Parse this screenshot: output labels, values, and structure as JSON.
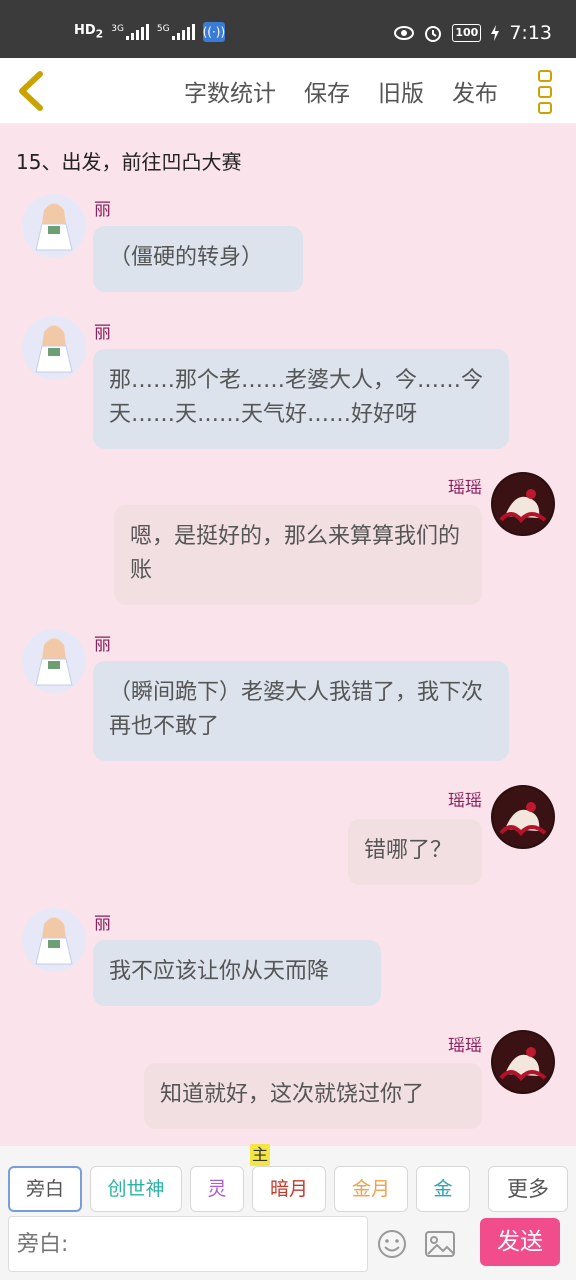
{
  "status_bar": {
    "hd": "HD",
    "hd_sub": "2",
    "sig1_label": "3G",
    "sig2_label": "5G",
    "wifi_label": "((·))",
    "battery": "100",
    "time": "7:13",
    "icons": [
      "eye-icon",
      "alarm-icon",
      "charging-icon"
    ]
  },
  "toolbar": {
    "actions": [
      "字数统计",
      "保存",
      "旧版",
      "发布"
    ],
    "accent_color": "#c9a300"
  },
  "chat": {
    "chapter_title": "15、出发，前往凹凸大赛",
    "messages": [
      {
        "side": "left",
        "name": "丽",
        "text": "（僵硬的转身）"
      },
      {
        "side": "left",
        "name": "丽",
        "text": "那……那个老……老婆大人，今……今天……天……天气好……好好呀"
      },
      {
        "side": "right",
        "name": "瑶瑶",
        "text": "嗯，是挺好的，那么来算算我们的账"
      },
      {
        "side": "left",
        "name": "丽",
        "text": "（瞬间跪下）老婆大人我错了，我下次再也不敢了"
      },
      {
        "side": "right",
        "name": "瑶瑶",
        "text": "错哪了？"
      },
      {
        "side": "left",
        "name": "丽",
        "text": "我不应该让你从天而降"
      },
      {
        "side": "right",
        "name": "瑶瑶",
        "text": "知道就好，这次就饶过你了"
      }
    ]
  },
  "bottom_bar": {
    "chips": [
      {
        "label": "旁白",
        "color": "#555555"
      },
      {
        "label": "创世神",
        "color": "#2ab3a6"
      },
      {
        "label": "灵",
        "color": "#b45ad6"
      },
      {
        "label": "暗月",
        "color": "#c8392b"
      },
      {
        "label": "金月",
        "color": "#f0a247"
      },
      {
        "label": "金",
        "color": "#2aa3b8"
      }
    ],
    "main_badge": "主",
    "more_label": "更多",
    "input_placeholder": "旁白:",
    "send_label": "发送",
    "send_color": "#f14d8c"
  }
}
